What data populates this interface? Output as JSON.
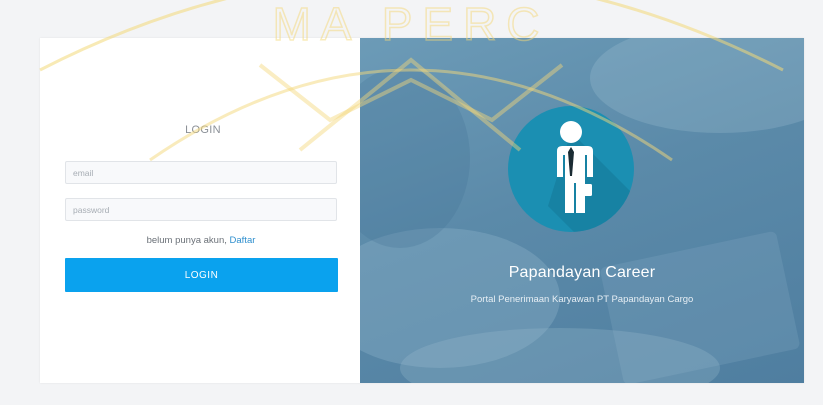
{
  "watermark": {
    "text": "MA PERC"
  },
  "login": {
    "title": "LOGIN",
    "email_placeholder": "email",
    "password_placeholder": "password",
    "register_prompt": "belum punya akun, ",
    "register_link": "Daftar",
    "submit_label": "LOGIN"
  },
  "hero": {
    "brand": "Papandayan Career",
    "tagline": "Portal Penerimaan Karyawan PT Papandayan Cargo",
    "avatar_icon": "businessman-icon"
  },
  "colors": {
    "login_button": "#0aa2ee",
    "link": "#2f8fce",
    "hero_overlay": "#5b8aa9",
    "avatar_circle": "#1b8fb2",
    "watermark": "#f3d879"
  }
}
